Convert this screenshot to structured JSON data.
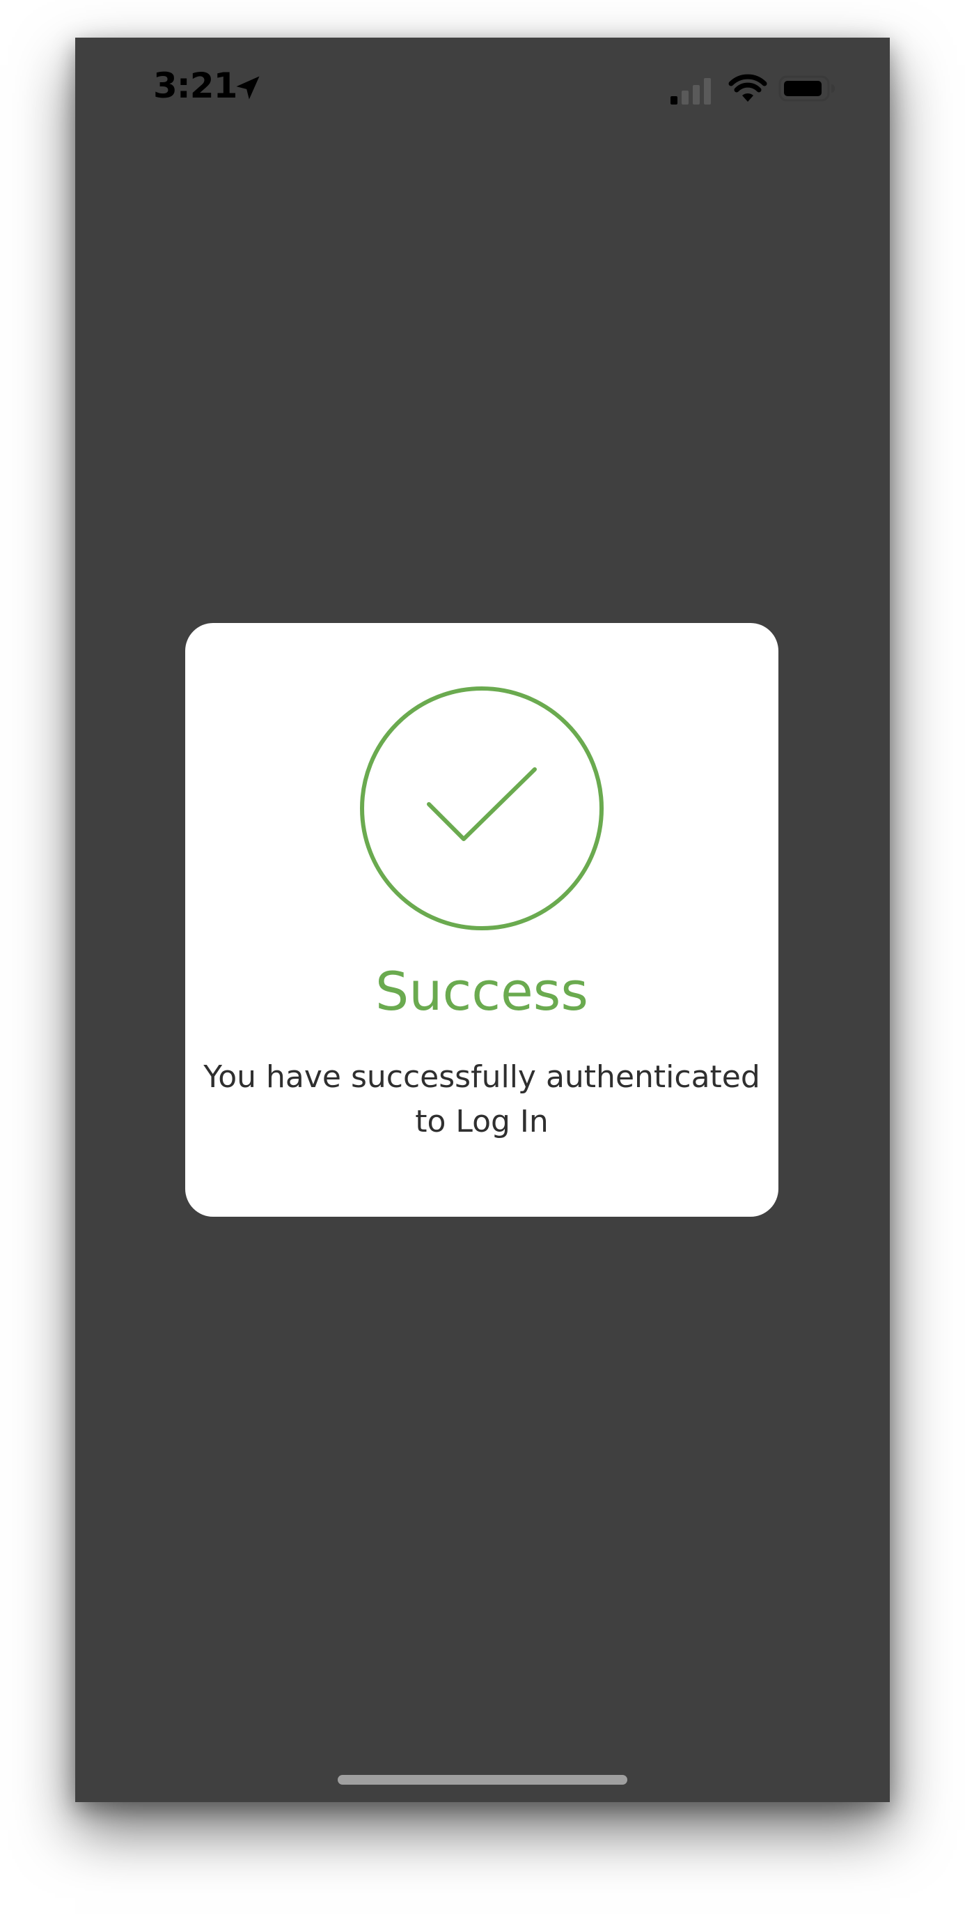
{
  "status_bar": {
    "time": "3:21",
    "icons": [
      "location-arrow-icon",
      "cellular-signal-icon",
      "wifi-icon",
      "battery-icon"
    ]
  },
  "modal": {
    "icon": "check-circle-icon",
    "title": "Success",
    "message": "You have successfully authenticated to Log In"
  },
  "colors": {
    "background": "#404040",
    "modal_background": "#ffffff",
    "accent": "#6aaa4f",
    "message_text": "#2f2f2f"
  }
}
